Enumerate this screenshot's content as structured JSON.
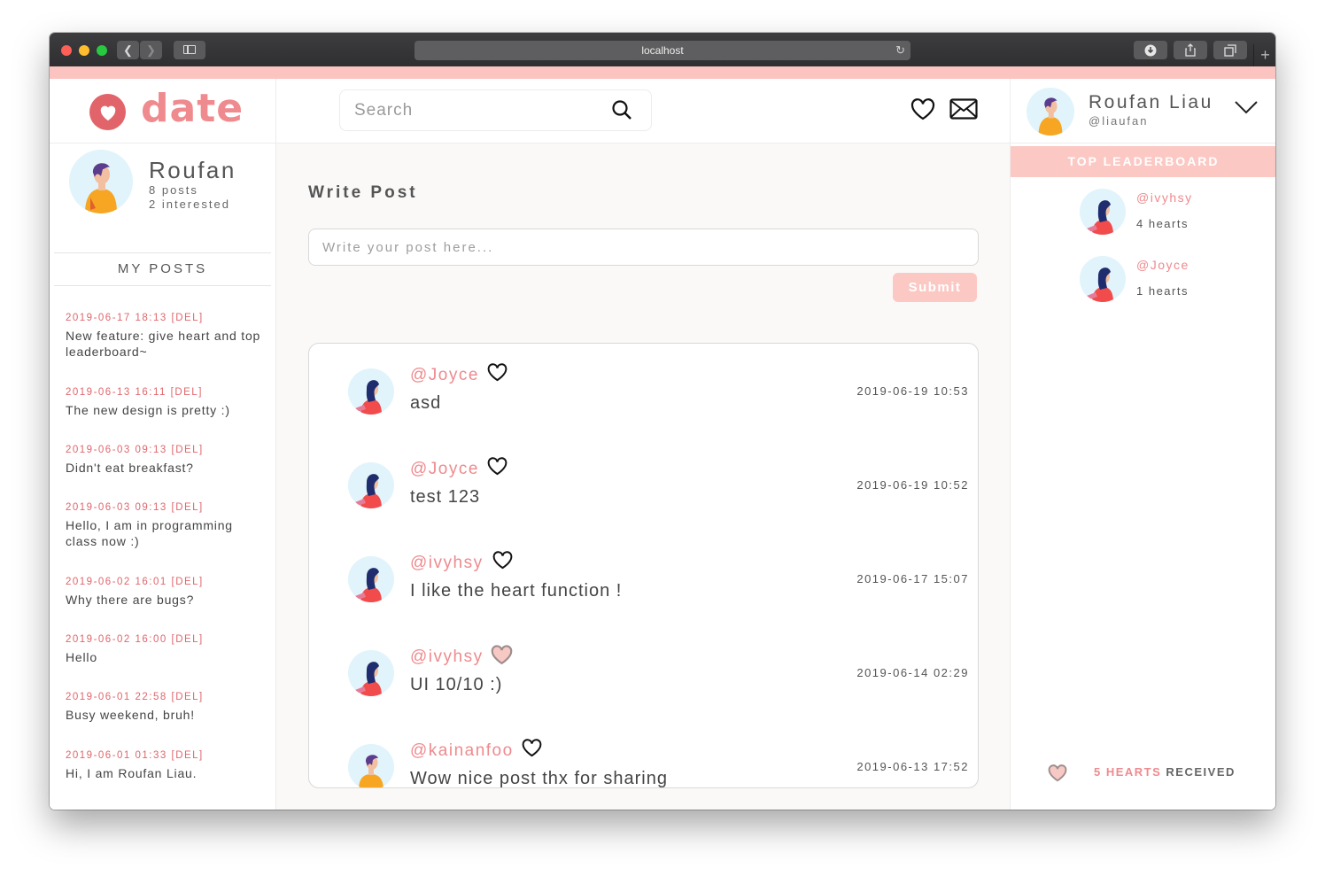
{
  "browser": {
    "url": "localhost"
  },
  "app": {
    "logo_text": "date"
  },
  "search": {
    "placeholder": "Search"
  },
  "profile": {
    "name": "Roufan",
    "posts": "8 posts",
    "interested": "2 interested"
  },
  "my_posts": {
    "title": "MY POSTS",
    "items": [
      {
        "meta": "2019-06-17 18:13 [DEL]",
        "text": "New feature: give heart and top leaderboard~"
      },
      {
        "meta": "2019-06-13 16:11 [DEL]",
        "text": "The new design is pretty :)"
      },
      {
        "meta": "2019-06-03 09:13 [DEL]",
        "text": "Didn't eat breakfast?"
      },
      {
        "meta": "2019-06-03 09:13 [DEL]",
        "text": "Hello, I am in programming class now :)"
      },
      {
        "meta": "2019-06-02 16:01 [DEL]",
        "text": "Why there are bugs?"
      },
      {
        "meta": "2019-06-02 16:00 [DEL]",
        "text": "Hello"
      },
      {
        "meta": "2019-06-01 22:58 [DEL]",
        "text": "Busy weekend, bruh!"
      },
      {
        "meta": "2019-06-01 01:33 [DEL]",
        "text": "Hi, I am Roufan Liau."
      }
    ]
  },
  "write_post": {
    "title": "Write Post",
    "placeholder": "Write your post here...",
    "submit_label": "Submit"
  },
  "feed": [
    {
      "user": "@Joyce",
      "text": "asd",
      "time": "2019-06-19 10:53",
      "hearted": false
    },
    {
      "user": "@Joyce",
      "text": "test 123",
      "time": "2019-06-19 10:52",
      "hearted": false
    },
    {
      "user": "@ivyhsy",
      "text": "I like the heart function !",
      "time": "2019-06-17 15:07",
      "hearted": false
    },
    {
      "user": "@ivyhsy",
      "text": "UI 10/10 :)",
      "time": "2019-06-14 02:29",
      "hearted": true
    },
    {
      "user": "@kainanfoo",
      "text": "Wow nice post thx for sharing",
      "time": "2019-06-13 17:52",
      "hearted": false
    }
  ],
  "account": {
    "name": "Roufan Liau",
    "handle": "@liaufan"
  },
  "leaderboard": {
    "title": "TOP LEADERBOARD",
    "items": [
      {
        "user": "@ivyhsy",
        "hearts": "4 hearts"
      },
      {
        "user": "@Joyce",
        "hearts": "1 hearts"
      }
    ]
  },
  "received": {
    "count": "5 HEARTS",
    "label": "RECEIVED"
  },
  "colors": {
    "accent": "#ef8a8e",
    "logo_red": "#e2646b",
    "pink_light": "#fcc8c4"
  }
}
